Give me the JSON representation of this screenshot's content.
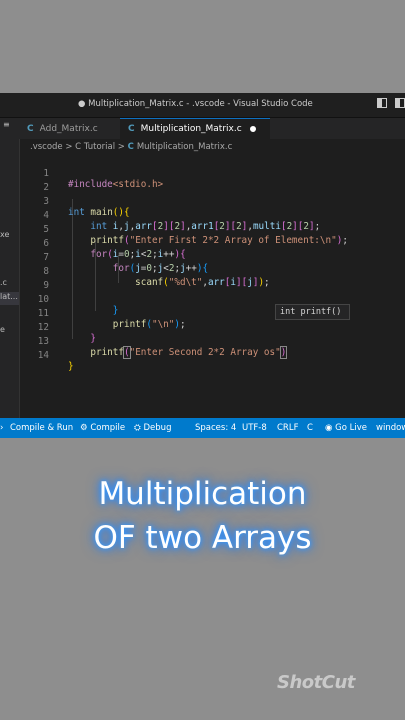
{
  "window": {
    "title": "● Multiplication_Matrix.c - .vscode - Visual Studio Code"
  },
  "sidebar": {
    "fragments": [
      "xe",
      ".c",
      "lat...",
      "e"
    ]
  },
  "tabs": [
    {
      "label": "Add_Matrix.c",
      "icon": "c-file-icon",
      "active": false
    },
    {
      "label": "Multiplication_Matrix.c",
      "icon": "c-file-icon",
      "active": true,
      "modified": true
    }
  ],
  "breadcrumb": {
    "path": ".vscode > C Tutorial >",
    "file": "Multiplication_Matrix.c"
  },
  "editor": {
    "line_numbers": [
      "1",
      "2",
      "3",
      "4",
      "5",
      "6",
      "7",
      "8",
      "9",
      "10",
      "11",
      "12",
      "13",
      "14"
    ],
    "lines": [
      "#include<stdio.h>",
      "",
      "int main(){",
      "    int i,j,arr[2][2],arr1[2][2],multi[2][2];",
      "    printf(\"Enter First 2*2 Array of Element:\\n\");",
      "    for(i=0;i<2;i++){",
      "        for(j=0;j<2;j++){",
      "            scanf(\"%d\\t\",arr[i][j]);",
      "",
      "        }",
      "        printf(\"\\n\");",
      "    }",
      "    printf(\"Enter Second 2*2 Array os\")",
      "}"
    ],
    "tooltip": "int printf()"
  },
  "statusbar": {
    "items": [
      "Compile & Run",
      "Compile",
      "Debug",
      "Spaces: 4",
      "UTF-8",
      "CRLF",
      "C",
      "Go Live",
      "window"
    ]
  },
  "caption": {
    "line1": "Multiplication",
    "line2": "OF two Arrays"
  },
  "watermark": "ShotCut",
  "colors": {
    "statusbar": "#007acc",
    "editor_bg": "#1e1e1e",
    "caption_glow": "#1e7fff",
    "page_bg": "#8e8e8e"
  }
}
